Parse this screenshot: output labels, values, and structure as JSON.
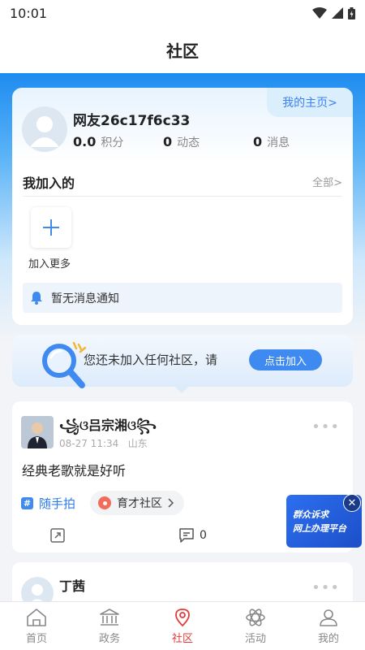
{
  "status_bar": {
    "time": "10:01"
  },
  "header": {
    "title": "社区"
  },
  "profile": {
    "home_link": "我的主页>",
    "username": "网友26c17f6c33",
    "stats": [
      {
        "value": "0.0",
        "label": "积分"
      },
      {
        "value": "0",
        "label": "动态"
      },
      {
        "value": "0",
        "label": "消息"
      }
    ],
    "joined_title": "我加入的",
    "all_link": "全部>",
    "add_more": "加入更多",
    "notice": "暂无消息通知"
  },
  "banner": {
    "text": "您还未加入任何社区，请",
    "button": "点击加入"
  },
  "posts": [
    {
      "author": "꧁ଓ吕宗湘ଓ꧂",
      "time": "08-27 11:34",
      "location": "山东",
      "content": "经典老歌就是好听",
      "topic": "随手拍",
      "community": "育才社区",
      "comment_count": "0"
    },
    {
      "author": "丁茜"
    }
  ],
  "float_ad": {
    "line1": "群众诉求",
    "line2": "网上办理平台"
  },
  "tabs": [
    {
      "label": "首页"
    },
    {
      "label": "政务"
    },
    {
      "label": "社区"
    },
    {
      "label": "活动"
    },
    {
      "label": "我的"
    }
  ],
  "colors": {
    "primary": "#3e8af0",
    "active_tab": "#e23a3a",
    "header_gradient": "#1e8cf0"
  }
}
